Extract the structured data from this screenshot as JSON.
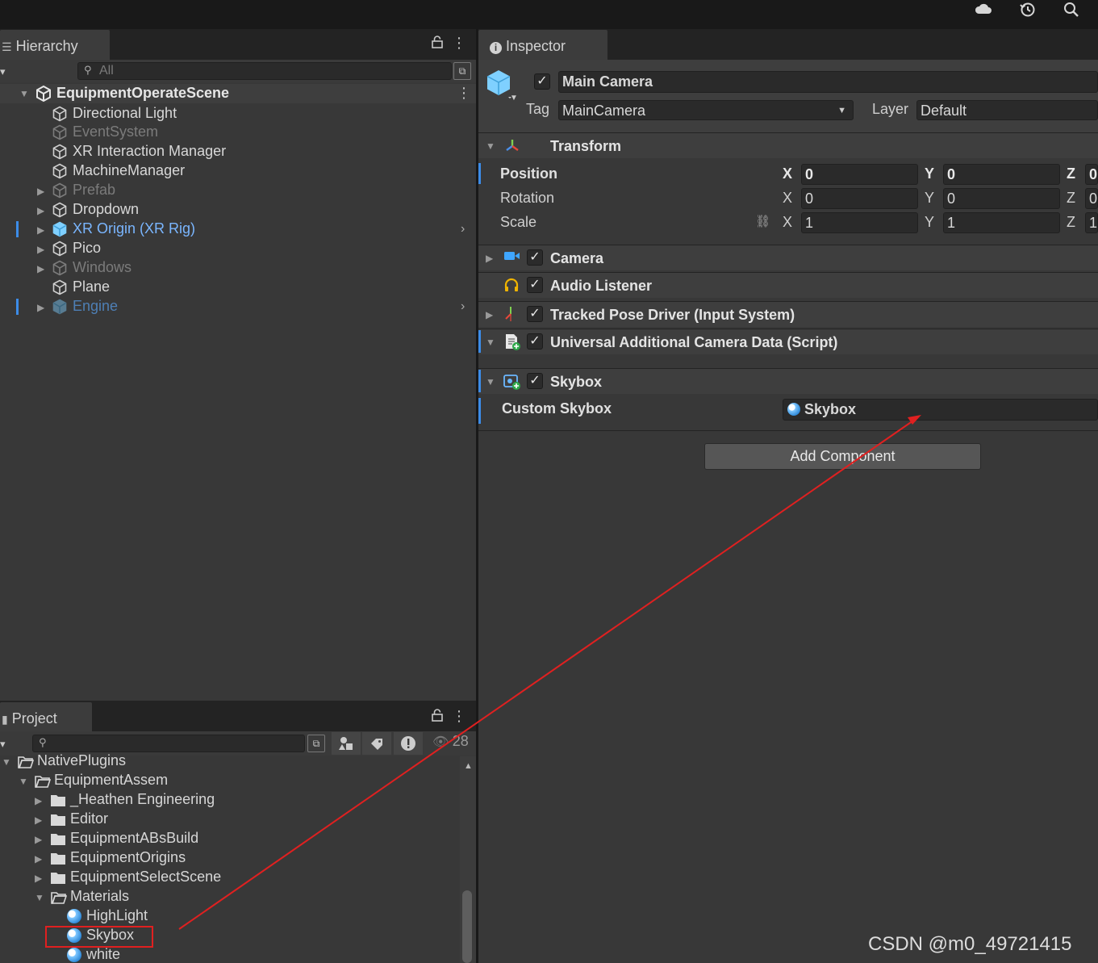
{
  "topbar": {
    "icons": [
      "cloud-icon",
      "history-icon",
      "search-icon"
    ]
  },
  "hierarchy": {
    "tab_label": "Hierarchy",
    "search_placeholder": "All",
    "scene_name": "EquipmentOperateScene",
    "items": [
      {
        "label": "Directional Light",
        "state": "normal",
        "expand": false
      },
      {
        "label": "EventSystem",
        "state": "dim",
        "expand": false
      },
      {
        "label": "XR Interaction Manager",
        "state": "normal",
        "expand": false
      },
      {
        "label": "MachineManager",
        "state": "normal",
        "expand": false
      },
      {
        "label": "Prefab",
        "state": "dim",
        "expand": true
      },
      {
        "label": "Dropdown",
        "state": "normal",
        "expand": true
      },
      {
        "label": "XR Origin (XR Rig)",
        "state": "prefab",
        "expand": true
      },
      {
        "label": "Pico",
        "state": "normal",
        "expand": true
      },
      {
        "label": "Windows",
        "state": "dim",
        "expand": true
      },
      {
        "label": "Plane",
        "state": "normal",
        "expand": false
      },
      {
        "label": "Engine",
        "state": "prefab-dim",
        "expand": true
      }
    ]
  },
  "project": {
    "tab_label": "Project",
    "hidden_count": "28",
    "tree": {
      "root": "NativePlugins",
      "sub": "EquipmentAssem",
      "folders": [
        "_Heathen Engineering",
        "Editor",
        "EquipmentABsBuild",
        "EquipmentOrigins",
        "EquipmentSelectScene"
      ],
      "open_folder": "Materials",
      "materials": [
        "HighLight",
        "Skybox",
        "white"
      ]
    }
  },
  "inspector": {
    "tab_label": "Inspector",
    "object_name": "Main Camera",
    "tag_label": "Tag",
    "tag_value": "MainCamera",
    "layer_label": "Layer",
    "layer_value": "Default",
    "transform": {
      "title": "Transform",
      "rows": [
        {
          "label": "Position",
          "x": "0",
          "y": "0",
          "z": "0"
        },
        {
          "label": "Rotation",
          "x": "0",
          "y": "0",
          "z": "0"
        },
        {
          "label": "Scale",
          "x": "1",
          "y": "1",
          "z": "1"
        }
      ],
      "axes": [
        "X",
        "Y",
        "Z"
      ]
    },
    "components": [
      {
        "title": "Camera",
        "icon": "camera-icon"
      },
      {
        "title": "Audio Listener",
        "icon": "headphones-icon"
      },
      {
        "title": "Tracked Pose Driver (Input System)",
        "icon": "pose-driver-icon"
      },
      {
        "title": "Universal Additional Camera Data (Script)",
        "icon": "script-icon"
      },
      {
        "title": "Skybox",
        "icon": "skybox-icon"
      }
    ],
    "skybox": {
      "prop_label": "Custom Skybox",
      "value": "Skybox"
    },
    "add_component": "Add Component"
  },
  "watermark": "CSDN @m0_49721415",
  "accent_colors": {
    "selection_blue": "#3c8ce8",
    "prefab_text": "#7ab6ff",
    "annotation_red": "#e02020"
  }
}
